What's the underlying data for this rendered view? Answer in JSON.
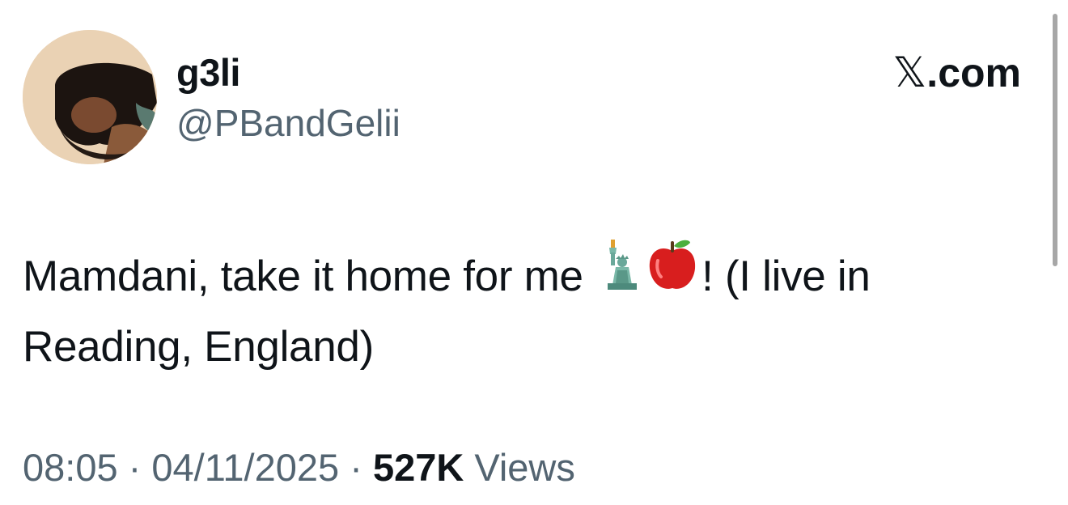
{
  "author": {
    "display_name": "g3li",
    "handle": "@PBandGelii",
    "avatar_icon": "profile-photo"
  },
  "brand": {
    "glyph": "𝕏",
    "suffix": ".com"
  },
  "tweet": {
    "text_before_emoji": "Mamdani, take it home for me ",
    "emojis": [
      "statue-of-liberty-emoji",
      "red-apple-emoji"
    ],
    "text_after_emoji": "! (I live in Reading, England)"
  },
  "meta": {
    "time": "08:05",
    "separator": " · ",
    "date": "04/11/2025",
    "views_count": "527K",
    "views_label": " Views"
  },
  "colors": {
    "text_primary": "#0f1419",
    "text_secondary": "#536471",
    "background": "#ffffff"
  }
}
